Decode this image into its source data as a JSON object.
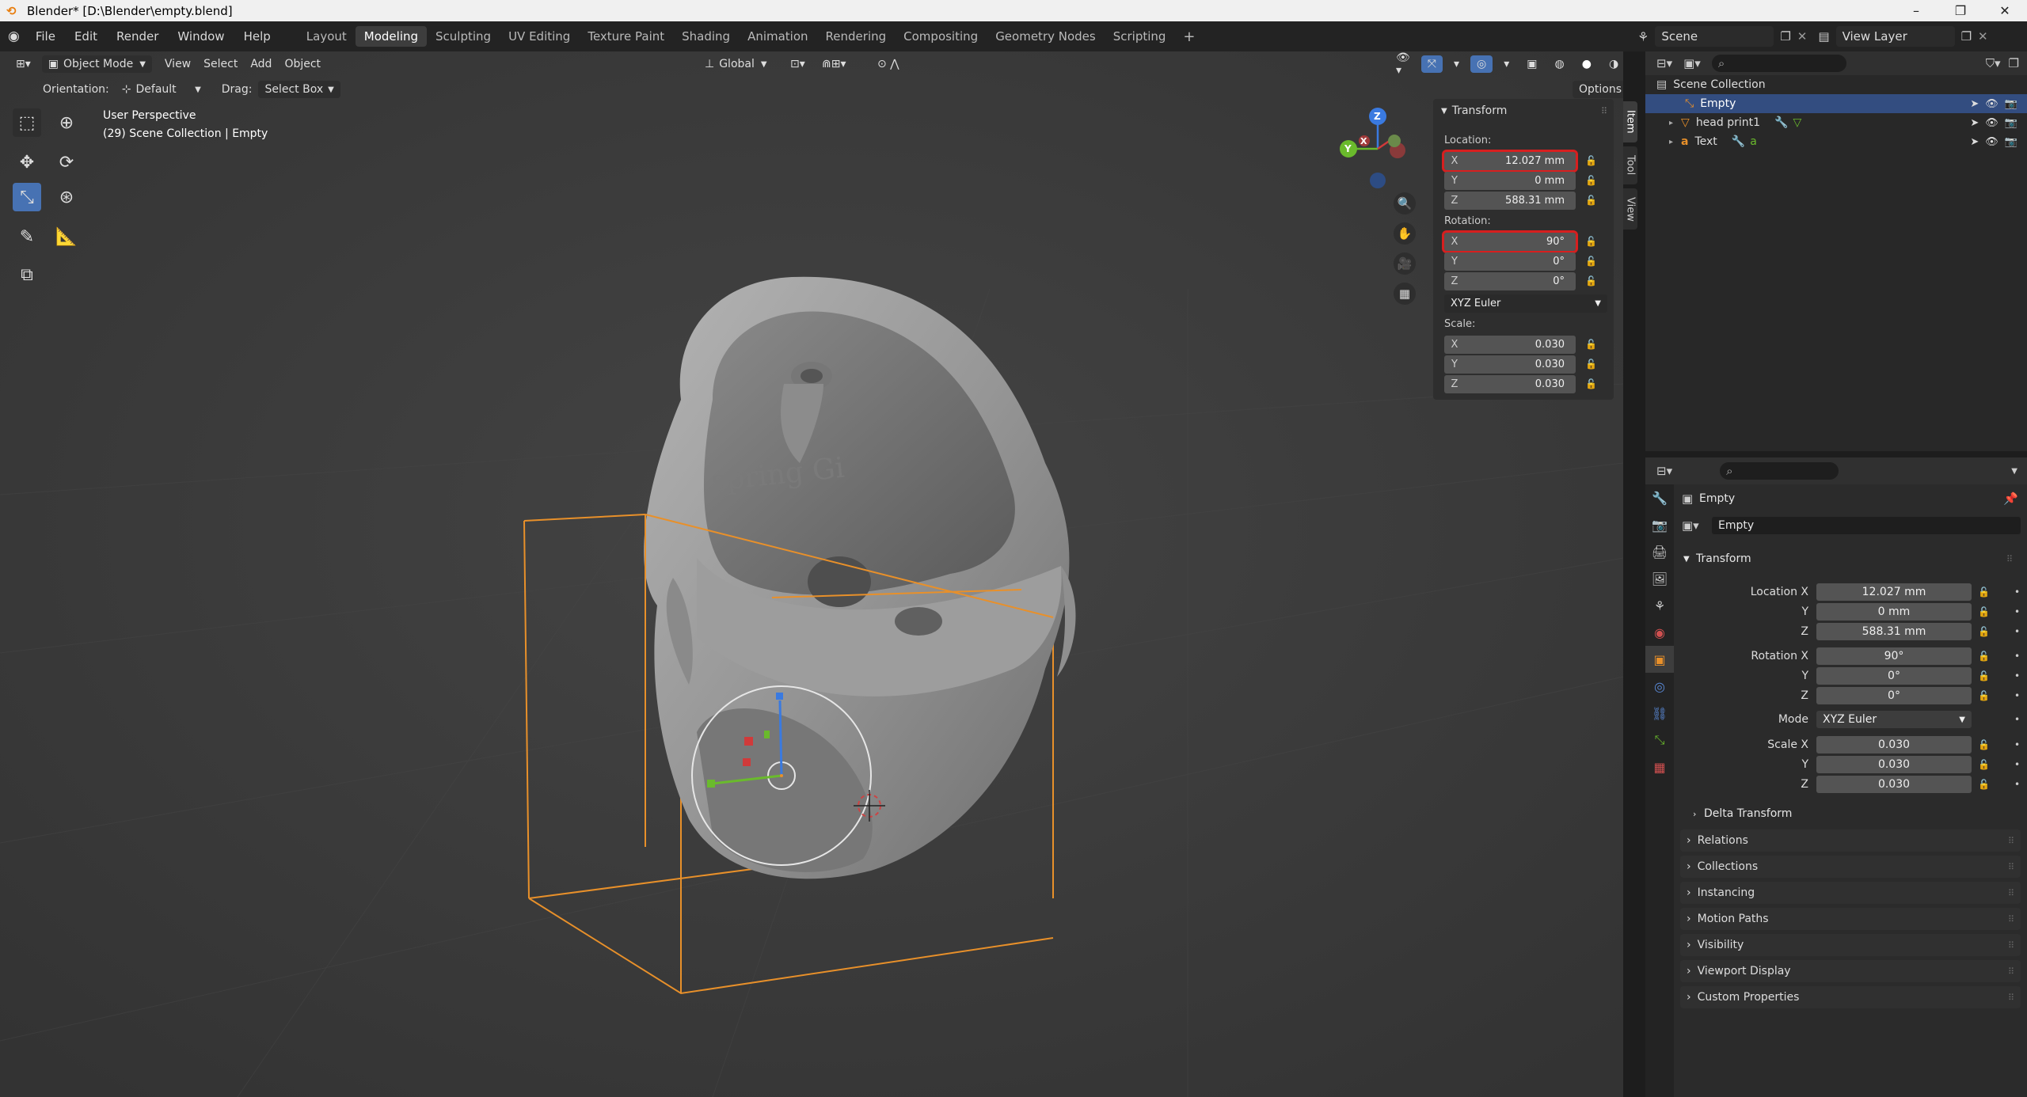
{
  "window": {
    "title": "Blender* [D:\\Blender\\empty.blend]",
    "minimize": "–",
    "restore": "❐",
    "close": "✕"
  },
  "menu": [
    "File",
    "Edit",
    "Render",
    "Window",
    "Help"
  ],
  "workspaces": [
    "Layout",
    "Modeling",
    "Sculpting",
    "UV Editing",
    "Texture Paint",
    "Shading",
    "Animation",
    "Rendering",
    "Compositing",
    "Geometry Nodes",
    "Scripting"
  ],
  "active_workspace": "Modeling",
  "add_workspace": "+",
  "scene": {
    "name": "Scene",
    "view_layer": "View Layer"
  },
  "viewport_header": {
    "mode": "Object Mode",
    "menus": [
      "View",
      "Select",
      "Add",
      "Object"
    ],
    "transform_orientation": "Global",
    "orientation_label": "Orientation:",
    "orientation_value": "Default",
    "drag_label": "Drag:",
    "drag_value": "Select Box",
    "options": "Options"
  },
  "viewport_info": {
    "line1": "User Perspective",
    "line2": "(29) Scene Collection | Empty"
  },
  "viewport_text_mesh": "spring Gi",
  "gizmo": {
    "x": "X",
    "y": "Y",
    "z": "Z"
  },
  "npanel": {
    "title": "Transform",
    "location_label": "Location:",
    "location": [
      {
        "axis": "X",
        "value": "12.027 mm"
      },
      {
        "axis": "Y",
        "value": "0 mm"
      },
      {
        "axis": "Z",
        "value": "588.31 mm"
      }
    ],
    "rotation_label": "Rotation:",
    "rotation": [
      {
        "axis": "X",
        "value": "90°"
      },
      {
        "axis": "Y",
        "value": "0°"
      },
      {
        "axis": "Z",
        "value": "0°"
      }
    ],
    "rotation_mode": "XYZ Euler",
    "scale_label": "Scale:",
    "scale": [
      {
        "axis": "X",
        "value": "0.030"
      },
      {
        "axis": "Y",
        "value": "0.030"
      },
      {
        "axis": "Z",
        "value": "0.030"
      }
    ],
    "tabs": [
      "Item",
      "Tool",
      "View"
    ]
  },
  "outliner": {
    "root": "Scene Collection",
    "items": [
      {
        "name": "Empty",
        "selected": true
      },
      {
        "name": "head print1",
        "selected": false
      },
      {
        "name": "Text",
        "selected": false
      }
    ]
  },
  "properties": {
    "object_name": "Empty",
    "data_name": "Empty",
    "transform_title": "Transform",
    "location_x_label": "Location X",
    "location": [
      "12.027 mm",
      "0 mm",
      "588.31 mm"
    ],
    "rotation_x_label": "Rotation X",
    "rotation": [
      "90°",
      "0°",
      "0°"
    ],
    "mode_label": "Mode",
    "mode_value": "XYZ Euler",
    "scale_x_label": "Scale X",
    "scale": [
      "0.030",
      "0.030",
      "0.030"
    ],
    "y_label": "Y",
    "z_label": "Z",
    "delta_transform": "Delta Transform",
    "sections": [
      "Relations",
      "Collections",
      "Instancing",
      "Motion Paths",
      "Visibility",
      "Viewport Display",
      "Custom Properties"
    ]
  },
  "colors": {
    "accent": "#4772b3",
    "selection_outline": "#e8902a",
    "highlight_box": "#d71f1f",
    "outliner_selected": "#334d80"
  }
}
